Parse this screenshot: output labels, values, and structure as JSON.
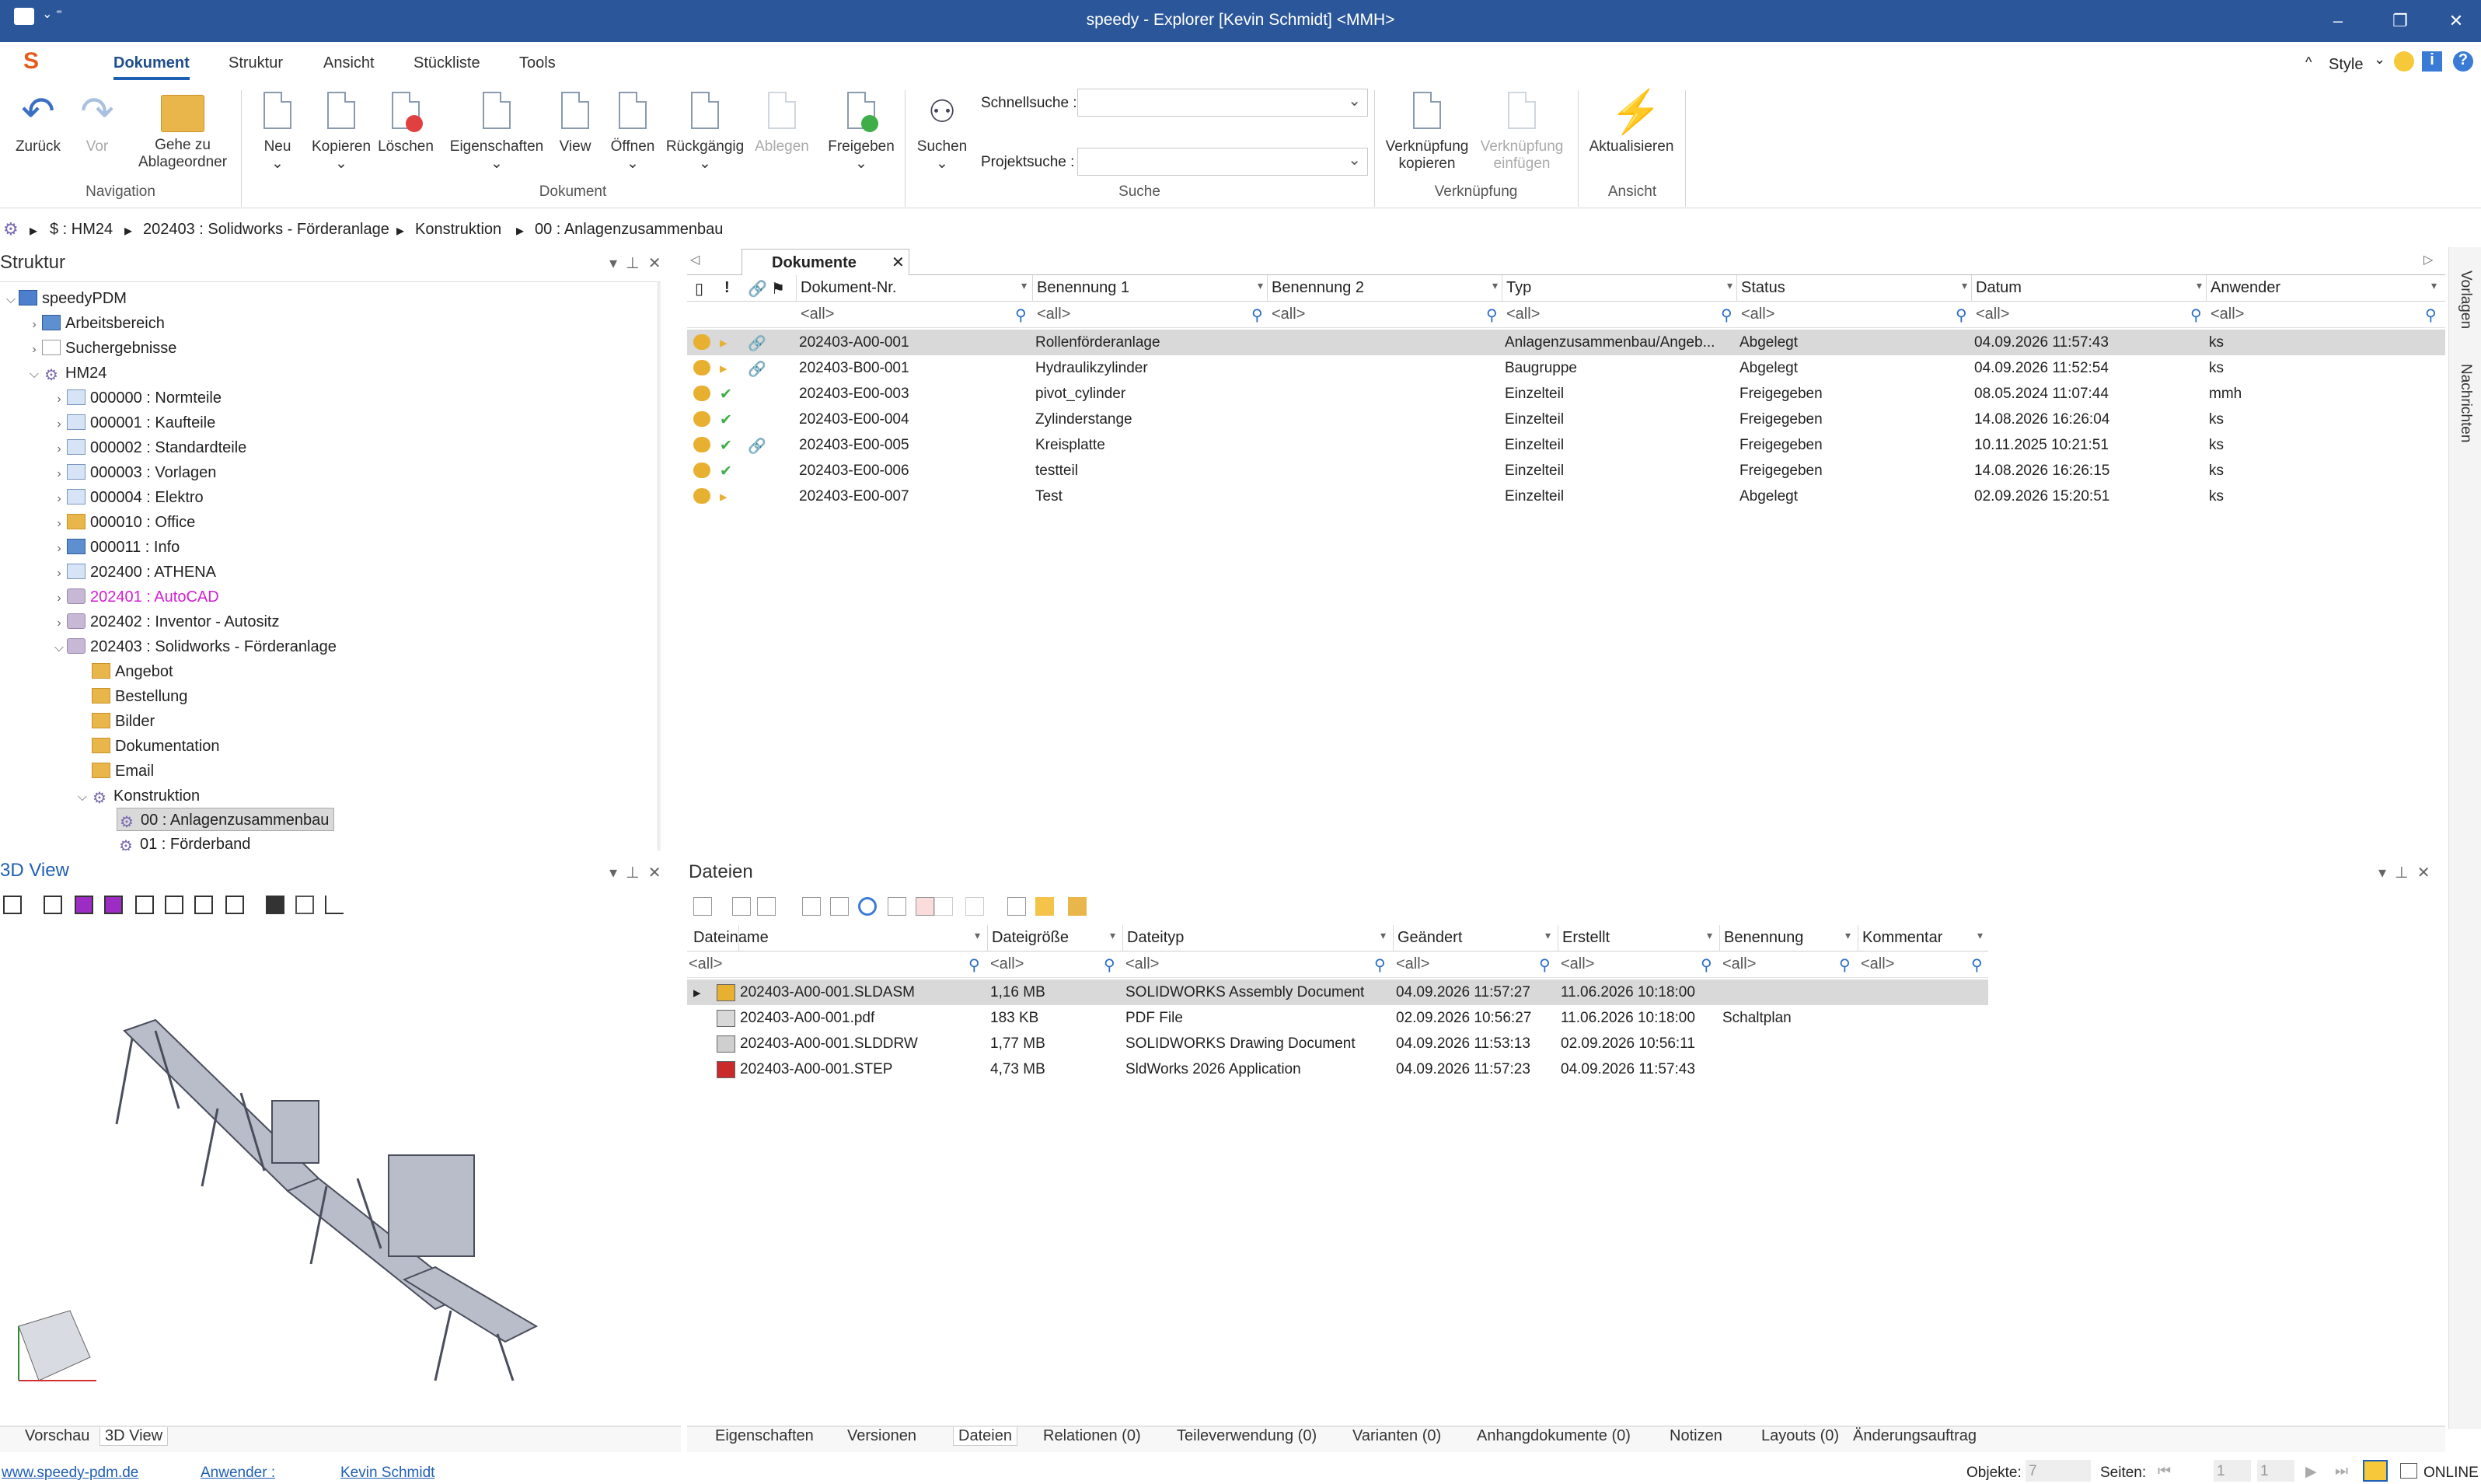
{
  "window": {
    "title": "speedy - Explorer [Kevin Schmidt] <MMH>",
    "style_label": "Style"
  },
  "ribbon_tabs": [
    "Dokument",
    "Struktur",
    "Ansicht",
    "Stückliste",
    "Tools"
  ],
  "ribbon": {
    "navigation": {
      "back": "Zurück",
      "forward": "Vor",
      "goto_l1": "Gehe zu",
      "goto_l2": "Ablageordner",
      "group": "Navigation"
    },
    "dokument": {
      "new": "Neu",
      "copy": "Kopieren",
      "delete": "Löschen",
      "properties": "Eigenschaften",
      "view": "View",
      "open": "Öffnen",
      "undo": "Rückgängig",
      "file": "Ablegen",
      "release": "Freigeben",
      "group": "Dokument"
    },
    "suche": {
      "search": "Suchen",
      "quick": "Schnellsuche :",
      "project": "Projektsuche :",
      "group": "Suche"
    },
    "verknuepfung": {
      "copy_l1": "Verknüpfung",
      "copy_l2": "kopieren",
      "paste_l1": "Verknüpfung",
      "paste_l2": "einfügen",
      "group": "Verknüpfung"
    },
    "ansicht": {
      "refresh": "Aktualisieren",
      "group": "Ansicht"
    }
  },
  "breadcrumb": [
    "$ : HM24",
    "202403 : Solidworks - Förderanlage",
    "Konstruktion",
    "00 : Anlagenzusammenbau"
  ],
  "structure": {
    "title": "Struktur",
    "items": [
      {
        "label": "speedyPDM"
      },
      {
        "label": "Arbeitsbereich"
      },
      {
        "label": "Suchergebnisse"
      },
      {
        "label": "HM24"
      },
      {
        "label": "000000 : Normteile"
      },
      {
        "label": "000001 : Kaufteile"
      },
      {
        "label": "000002 : Standardteile"
      },
      {
        "label": "000003 : Vorlagen"
      },
      {
        "label": "000004 : Elektro"
      },
      {
        "label": "000010 : Office"
      },
      {
        "label": "000011 : Info"
      },
      {
        "label": "202400 : ATHENA"
      },
      {
        "label": "202401 : AutoCAD"
      },
      {
        "label": "202402 : Inventor - Autositz"
      },
      {
        "label": "202403 : Solidworks - Förderanlage"
      },
      {
        "label": "Angebot"
      },
      {
        "label": "Bestellung"
      },
      {
        "label": "Bilder"
      },
      {
        "label": "Dokumentation"
      },
      {
        "label": "Email"
      },
      {
        "label": "Konstruktion"
      },
      {
        "label": "00 : Anlagenzusammenbau"
      },
      {
        "label": "01 : Förderband"
      }
    ],
    "accent_magenta": "#d21fd2"
  },
  "documents": {
    "tab": "Dokumente",
    "filter": "<all>",
    "columns": [
      "Dokument-Nr.",
      "Benennung 1",
      "Benennung 2",
      "Typ",
      "Status",
      "Datum",
      "Anwender"
    ],
    "rows": [
      [
        "202403-A00-001",
        "Rollenförderanlage",
        "",
        "Anlagenzusammenbau/Angeb...",
        "Abgelegt",
        "04.09.2026 11:57:43",
        "ks"
      ],
      [
        "202403-B00-001",
        "Hydraulikzylinder",
        "",
        "Baugruppe",
        "Abgelegt",
        "04.09.2026 11:52:54",
        "ks"
      ],
      [
        "202403-E00-003",
        "pivot_cylinder",
        "",
        "Einzelteil",
        "Freigegeben",
        "08.05.2024 11:07:44",
        "mmh"
      ],
      [
        "202403-E00-004",
        "Zylinderstange",
        "",
        "Einzelteil",
        "Freigegeben",
        "14.08.2026 16:26:04",
        "ks"
      ],
      [
        "202403-E00-005",
        "Kreisplatte",
        "",
        "Einzelteil",
        "Freigegeben",
        "10.11.2025 10:21:51",
        "ks"
      ],
      [
        "202403-E00-006",
        "testteil",
        "",
        "Einzelteil",
        "Freigegeben",
        "14.08.2026 16:26:15",
        "ks"
      ],
      [
        "202403-E00-007",
        "Test",
        "",
        "Einzelteil",
        "Abgelegt",
        "02.09.2026 15:20:51",
        "ks"
      ]
    ]
  },
  "view3d": {
    "title": "3D View"
  },
  "files": {
    "title": "Dateien",
    "filter": "<all>",
    "columns": [
      "Dateiname",
      "Dateigröße",
      "Dateityp",
      "Geändert",
      "Erstellt",
      "Benennung",
      "Kommentar"
    ],
    "rows": [
      [
        "202403-A00-001.SLDASM",
        "1,16 MB",
        "SOLIDWORKS Assembly Document",
        "04.09.2026 11:57:27",
        "11.06.2026 10:18:00",
        "",
        ""
      ],
      [
        "202403-A00-001.pdf",
        "183 KB",
        "PDF File",
        "02.09.2026 10:56:27",
        "11.06.2026 10:18:00",
        "Schaltplan",
        ""
      ],
      [
        "202403-A00-001.SLDDRW",
        "1,77 MB",
        "SOLIDWORKS Drawing Document",
        "04.09.2026 11:53:13",
        "02.09.2026 10:56:11",
        "",
        ""
      ],
      [
        "202403-A00-001.STEP",
        "4,73 MB",
        "SldWorks 2026 Application",
        "04.09.2026 11:57:23",
        "04.09.2026 11:57:43",
        "",
        ""
      ]
    ]
  },
  "bottom_tabs_left": [
    "Vorschau",
    "3D View"
  ],
  "bottom_tabs_right": [
    "Eigenschaften",
    "Versionen",
    "Dateien",
    "Relationen (0)",
    "Teileverwendung (0)",
    "Varianten (0)",
    "Anhangdokumente (0)",
    "Notizen",
    "Layouts (0)",
    "Änderungsauftrag"
  ],
  "side_tabs": [
    "Vorlagen",
    "Nachrichten"
  ],
  "status": {
    "website": "www.speedy-pdm.de",
    "user_label": "Anwender :",
    "user": "Kevin Schmidt",
    "objects_label": "Objekte:",
    "objects": "7",
    "pages_label": "Seiten:",
    "page": "1",
    "page_total": "1",
    "online": "ONLINE"
  }
}
